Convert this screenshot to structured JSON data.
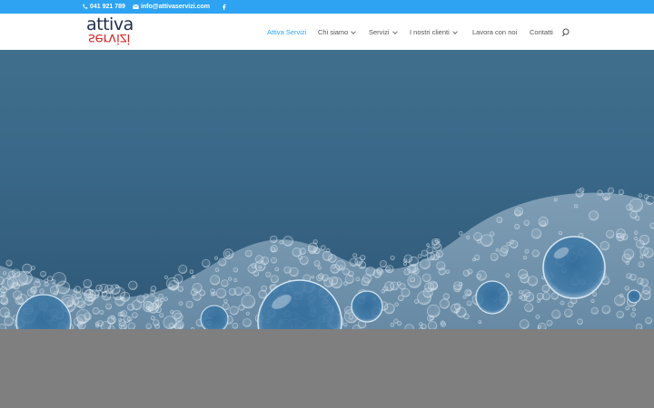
{
  "topbar": {
    "phone": "041 921 789",
    "email": "info@attivaservizi.com"
  },
  "header": {
    "logo": {
      "line1": "attiva",
      "line2": "servizi"
    },
    "nav": [
      {
        "label": "Attiva Servizi",
        "active": true,
        "dropdown": false
      },
      {
        "label": "Chi siamo",
        "active": false,
        "dropdown": true
      },
      {
        "label": "Servizi",
        "active": false,
        "dropdown": true
      },
      {
        "label": "I nostri clienti",
        "active": false,
        "dropdown": true
      },
      {
        "label": "Lavora con noi",
        "active": false,
        "dropdown": false
      },
      {
        "label": "Contatti",
        "active": false,
        "dropdown": false
      }
    ]
  },
  "colors": {
    "accent": "#2ea3f2",
    "hero": "#3a6888",
    "footer": "#7f7f7f",
    "logo_dark": "#1f2f4c",
    "logo_red": "#d32f2f"
  },
  "icons": [
    "phone-icon",
    "mail-icon",
    "facebook-icon",
    "search-icon",
    "chevron-down-icon"
  ]
}
